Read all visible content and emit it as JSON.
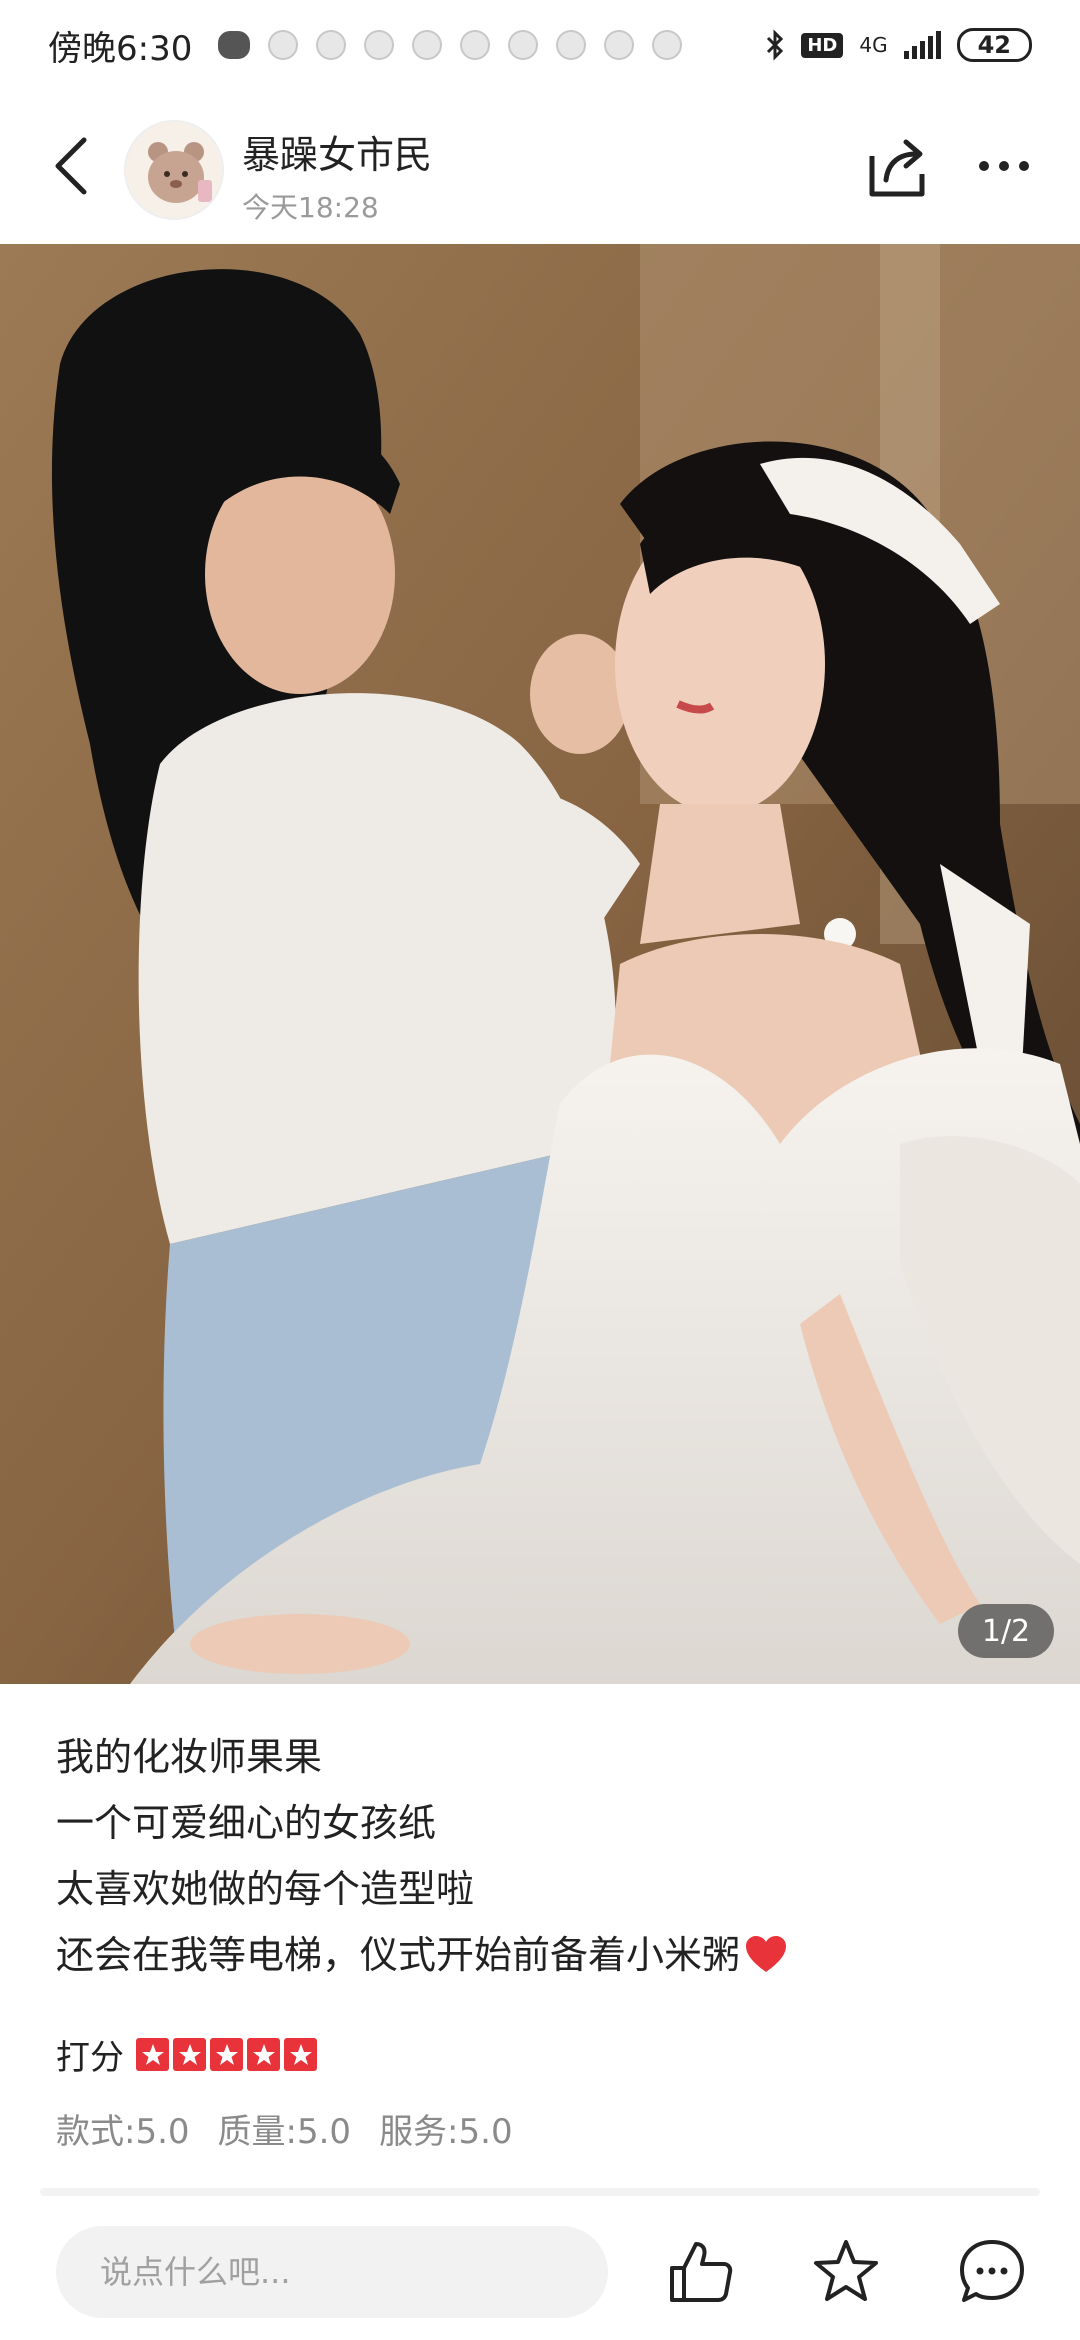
{
  "status_bar": {
    "time": "傍晚6:30",
    "network": "4G",
    "hd": "HD",
    "battery": "42"
  },
  "header": {
    "username": "暴躁女市民",
    "post_time": "今天18:28",
    "icons": [
      "back-icon",
      "share-icon",
      "more-icon"
    ]
  },
  "photo": {
    "pager": "1/2"
  },
  "post": {
    "lines": [
      "我的化妆师果果",
      "一个可爱细心的女孩纸",
      "太喜欢她做的每个造型啦",
      "还会在我等电梯，仪式开始前备着小米粥"
    ],
    "rating_label": "打分",
    "rating_stars": 5,
    "scores": [
      "款式:5.0",
      "质量:5.0",
      "服务:5.0"
    ]
  },
  "bottom_bar": {
    "comment_placeholder": "说点什么吧...",
    "icons": [
      "like-icon",
      "favorite-icon",
      "comment-icon"
    ]
  },
  "colors": {
    "star_red": "#e8333b",
    "text_dark": "#222222",
    "text_gray": "#8a8a8a"
  }
}
